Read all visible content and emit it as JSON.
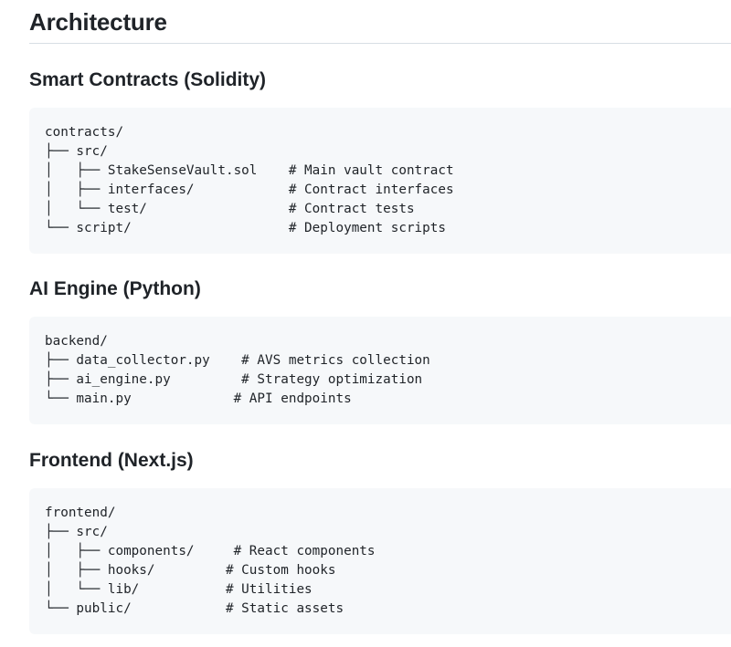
{
  "heading": "Architecture",
  "sections": [
    {
      "title": "Smart Contracts (Solidity)",
      "lines": [
        "contracts/",
        "├── src/",
        "│   ├── StakeSenseVault.sol    # Main vault contract",
        "│   ├── interfaces/            # Contract interfaces",
        "│   └── test/                  # Contract tests",
        "└── script/                    # Deployment scripts"
      ]
    },
    {
      "title": "AI Engine (Python)",
      "lines": [
        "backend/",
        "├── data_collector.py    # AVS metrics collection",
        "├── ai_engine.py         # Strategy optimization",
        "└── main.py             # API endpoints"
      ]
    },
    {
      "title": "Frontend (Next.js)",
      "lines": [
        "frontend/",
        "├── src/",
        "│   ├── components/     # React components",
        "│   ├── hooks/         # Custom hooks",
        "│   └── lib/           # Utilities",
        "└── public/            # Static assets"
      ]
    }
  ]
}
